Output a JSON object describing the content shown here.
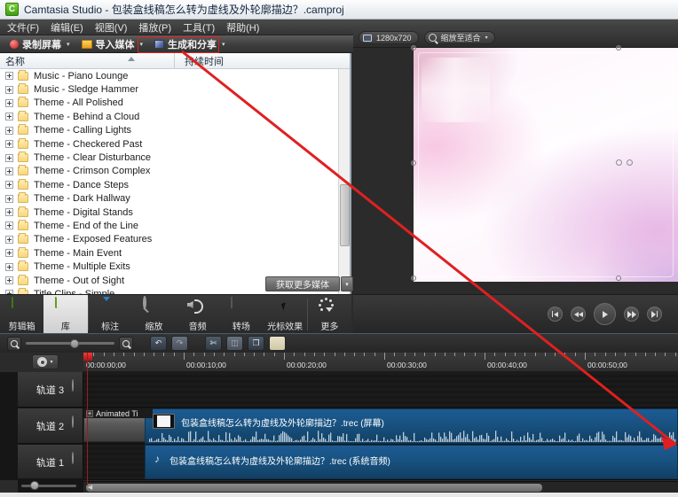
{
  "window": {
    "app_name": "Camtasia Studio",
    "title": "Camtasia Studio - 包装盒线稿怎么转为虚线及外轮廓描边？.camproj",
    "icon": "C"
  },
  "menubar": {
    "items": [
      {
        "label": "文件(F)"
      },
      {
        "label": "编辑(E)"
      },
      {
        "label": "视图(V)"
      },
      {
        "label": "播放(P)"
      },
      {
        "label": "工具(T)"
      },
      {
        "label": "帮助(H)"
      }
    ]
  },
  "toolbar": {
    "record_label": "录制屏幕",
    "import_label": "导入媒体",
    "produce_label": "生成和分享",
    "caret": "▾",
    "highlight_color": "#e02020"
  },
  "library": {
    "columns": {
      "name": "名称",
      "duration": "持续时间"
    },
    "get_more_label": "获取更多媒体",
    "get_more_caret": "▾",
    "items": [
      {
        "label": "Music - Piano Lounge"
      },
      {
        "label": "Music - Sledge Hammer"
      },
      {
        "label": "Theme - All Polished"
      },
      {
        "label": "Theme - Behind a Cloud"
      },
      {
        "label": "Theme - Calling Lights"
      },
      {
        "label": "Theme - Checkered Past"
      },
      {
        "label": "Theme - Clear Disturbance"
      },
      {
        "label": "Theme - Crimson Complex"
      },
      {
        "label": "Theme - Dance Steps"
      },
      {
        "label": "Theme - Dark Hallway"
      },
      {
        "label": "Theme - Digital Stands"
      },
      {
        "label": "Theme - End of the Line"
      },
      {
        "label": "Theme - Exposed Features"
      },
      {
        "label": "Theme - Main Event"
      },
      {
        "label": "Theme - Multiple Exits"
      },
      {
        "label": "Theme - Out of Sight"
      },
      {
        "label": "Title Clips - Simple"
      }
    ]
  },
  "tabs": [
    {
      "label": "剪辑箱",
      "icon": "clip-bin-icon",
      "active": false
    },
    {
      "label": "库",
      "icon": "library-icon",
      "active": true
    },
    {
      "label": "标注",
      "icon": "callout-icon",
      "active": false
    },
    {
      "label": "缩放",
      "icon": "zoom-pan-icon",
      "active": false
    },
    {
      "label": "音频",
      "icon": "audio-icon",
      "active": false
    },
    {
      "label": "转场",
      "icon": "transitions-icon",
      "active": false
    },
    {
      "label": "光标效果",
      "icon": "cursor-effects-icon",
      "active": false
    },
    {
      "label": "更多",
      "icon": "more-icon",
      "active": false
    }
  ],
  "preview": {
    "dimensions": "1280x720",
    "zoom_mode": "缩放至适合",
    "zoom_caret": "▾",
    "controls": [
      {
        "name": "skip-to-start"
      },
      {
        "name": "step-back"
      },
      {
        "name": "play"
      },
      {
        "name": "step-forward"
      },
      {
        "name": "skip-to-end"
      }
    ]
  },
  "timeline": {
    "ruler_labels": [
      "00:00:00;00",
      "00:00:10;00",
      "00:00:20;00",
      "00:00:30;00",
      "00:00:40;00",
      "00:00:50;00",
      "00:01:0"
    ],
    "toolbar_buttons": [
      {
        "name": "zoom-out-button",
        "glyph": ""
      },
      {
        "name": "zoom-in-button",
        "glyph": ""
      },
      {
        "name": "undo-button",
        "glyph": "↶"
      },
      {
        "name": "redo-button",
        "glyph": "↷"
      },
      {
        "name": "cut-button",
        "glyph": "✄"
      },
      {
        "name": "split-button",
        "glyph": "◫"
      },
      {
        "name": "copy-button",
        "glyph": "❐"
      },
      {
        "name": "paste-button",
        "glyph": ""
      }
    ],
    "tracks": [
      {
        "label": "轨道 3"
      },
      {
        "label": "轨道 2"
      },
      {
        "label": "轨道 1"
      }
    ],
    "clips": {
      "animated_title": "Animated Ti",
      "animated_title_plus": "+",
      "video_clip": "包装盒线稿怎么转为虚线及外轮廓描边？.trec (屏幕)",
      "audio_clip": "包装盒线稿怎么转为虚线及外轮廓描边？.trec (系统音频)",
      "audio_note_glyph": "♪"
    },
    "scroll_left_glyph": "◀"
  }
}
